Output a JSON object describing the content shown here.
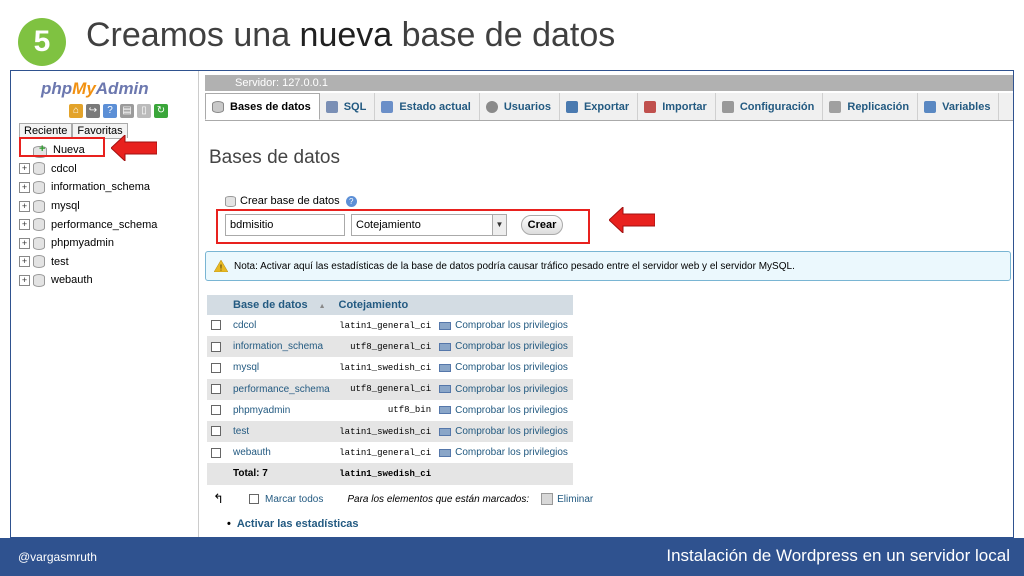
{
  "slide": {
    "step_number": "5",
    "title_part1": "Creamos una ",
    "title_bold": "nueva",
    "title_part2": " base de datos",
    "footer_left": "@vargasmruth",
    "footer_right": "Instalación de Wordpress en un servidor local",
    "accent_color": "#2f528f",
    "badge_color": "#7fc241",
    "highlight_color": "#e8211e"
  },
  "left_panel": {
    "logo_php": "php",
    "logo_my": "My",
    "logo_admin": "Admin",
    "tabs": [
      "Reciente",
      "Favoritas"
    ],
    "new_item": "Nueva",
    "databases": [
      "cdcol",
      "information_schema",
      "mysql",
      "performance_schema",
      "phpmyadmin",
      "test",
      "webauth"
    ],
    "icons": [
      "home-icon",
      "exit-icon",
      "help-icon",
      "docs-icon",
      "settings-icon",
      "reload-icon"
    ]
  },
  "breadcrumb": "Servidor: 127.0.0.1",
  "tabs": [
    {
      "label": "Bases de datos",
      "icon": "database-icon"
    },
    {
      "label": "SQL",
      "icon": "sql-icon"
    },
    {
      "label": "Estado actual",
      "icon": "status-icon"
    },
    {
      "label": "Usuarios",
      "icon": "users-icon"
    },
    {
      "label": "Exportar",
      "icon": "export-icon"
    },
    {
      "label": "Importar",
      "icon": "import-icon"
    },
    {
      "label": "Configuración",
      "icon": "wrench-icon"
    },
    {
      "label": "Replicación",
      "icon": "replication-icon"
    },
    {
      "label": "Variables",
      "icon": "variables-icon"
    }
  ],
  "main": {
    "heading": "Bases de datos",
    "create_label": "Crear base de datos",
    "dbname_value": "bdmisitio",
    "collation_value": "Cotejamiento",
    "create_button": "Crear",
    "note": "Nota: Activar aquí las estadísticas de la base de datos podría causar tráfico pesado entre el servidor web y el servidor MySQL."
  },
  "table": {
    "col_name": "Base de datos",
    "col_sort": "▲",
    "col_collation": "Cotejamiento",
    "privileges_label": "Comprobar los privilegios",
    "rows": [
      {
        "name": "cdcol",
        "collation": "latin1_general_ci"
      },
      {
        "name": "information_schema",
        "collation": "utf8_general_ci"
      },
      {
        "name": "mysql",
        "collation": "latin1_swedish_ci"
      },
      {
        "name": "performance_schema",
        "collation": "utf8_general_ci"
      },
      {
        "name": "phpmyadmin",
        "collation": "utf8_bin"
      },
      {
        "name": "test",
        "collation": "latin1_swedish_ci"
      },
      {
        "name": "webauth",
        "collation": "latin1_general_ci"
      }
    ],
    "total_label": "Total: 7",
    "total_collation": "latin1_swedish_ci"
  },
  "bottom": {
    "marcar_todos": "Marcar todos",
    "para_label": "Para los elementos que están marcados:",
    "eliminar": "Eliminar",
    "stats_link": "Activar las estadísticas"
  }
}
